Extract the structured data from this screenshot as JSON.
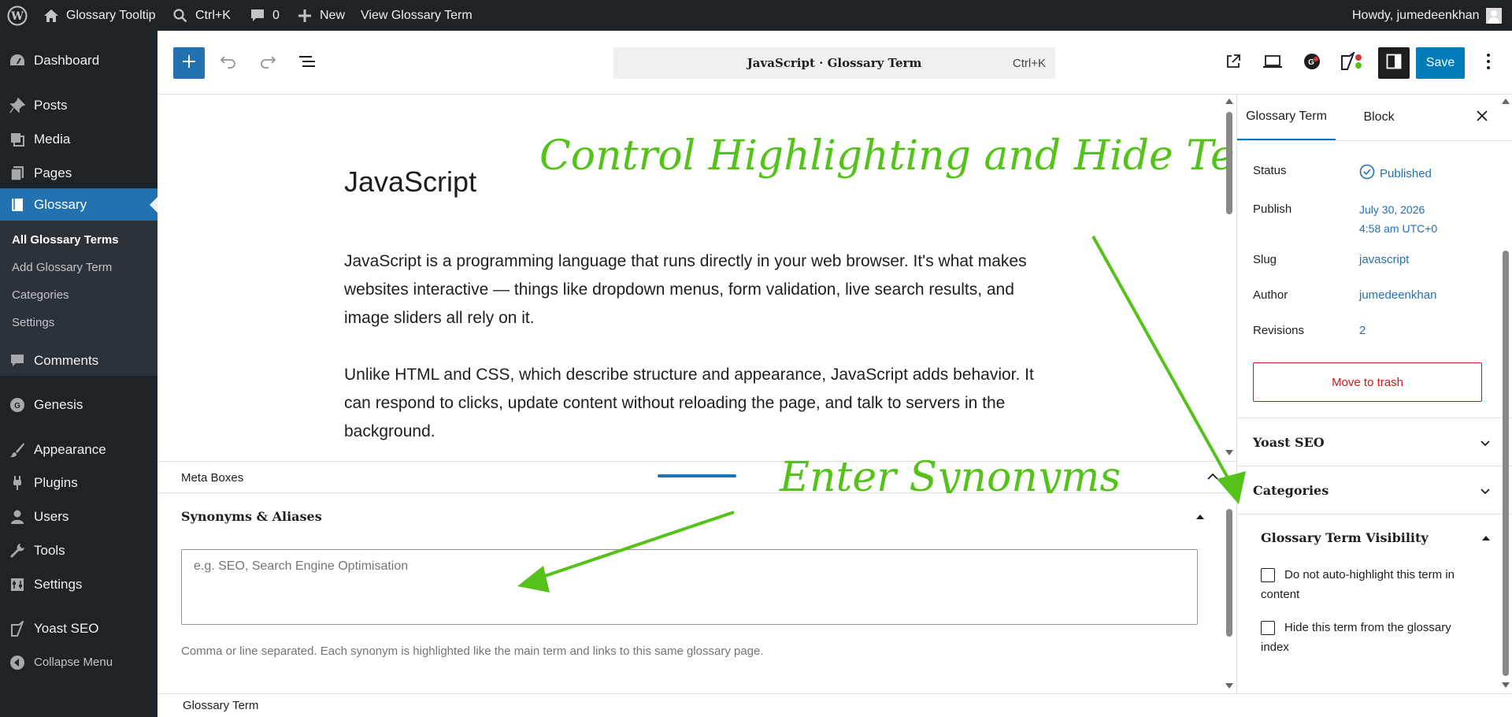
{
  "adminbar": {
    "site_name": "Glossary Tooltip",
    "search_shortcut": "Ctrl+K",
    "comments_count": "0",
    "new_label": "New",
    "view_label": "View Glossary Term",
    "howdy": "Howdy, jumedeenkhan"
  },
  "menu": {
    "dashboard": "Dashboard",
    "posts": "Posts",
    "media": "Media",
    "pages": "Pages",
    "glossary": "Glossary",
    "sub_all": "All Glossary Terms",
    "sub_add": "Add Glossary Term",
    "sub_categories": "Categories",
    "sub_settings": "Settings",
    "comments": "Comments",
    "genesis": "Genesis",
    "appearance": "Appearance",
    "plugins": "Plugins",
    "users": "Users",
    "tools": "Tools",
    "settings": "Settings",
    "yoast": "Yoast SEO",
    "collapse": "Collapse Menu"
  },
  "toolbar": {
    "doc_title": "JavaScript · Glossary Term",
    "shortcut": "Ctrl+K",
    "save_label": "Save"
  },
  "post": {
    "title": "JavaScript",
    "para1": "JavaScript is a programming language that runs directly in your web browser. It's what makes websites interactive — things like dropdown menus, form validation, live search results, and image sliders all rely on it.",
    "para2": "Unlike HTML and CSS, which describe structure and appearance, JavaScript adds behavior. It can respond to clicks, update content without reloading the page, and talk to servers in the background."
  },
  "annotations": {
    "top": "Control Highlighting and Hide Term",
    "mid": "Enter Synonyms"
  },
  "metaboxes": {
    "label": "Meta Boxes",
    "synonyms_title": "Synonyms & Aliases",
    "synonyms_placeholder": "e.g. SEO, Search Engine Optimisation",
    "synonyms_value": "",
    "synonyms_help": "Comma or line separated. Each synonym is highlighted like the main term and links to this same glossary page."
  },
  "footer": {
    "breadcrumb": "Glossary Term"
  },
  "sidebar": {
    "tab_doc": "Glossary Term",
    "tab_block": "Block",
    "status_label": "Status",
    "status_value": "Published",
    "publish_label": "Publish",
    "publish_date": "July 30, 2026",
    "publish_time": "4:58 am UTC+0",
    "slug_label": "Slug",
    "slug_value": "javascript",
    "author_label": "Author",
    "author_value": "jumedeenkhan",
    "revisions_label": "Revisions",
    "revisions_value": "2",
    "trash_label": "Move to trash",
    "yoast_panel": "Yoast SEO",
    "categories_panel": "Categories",
    "visibility_panel": "Glossary Term Visibility",
    "cb1_label": "Do not auto-highlight this term in content",
    "cb2_label": "Hide this term from the glossary index"
  },
  "colors": {
    "admin_bg": "#1d2327",
    "accent": "#2271b1",
    "save_bg": "#007cba",
    "annotation": "#55c21a",
    "danger": "#cc1818"
  }
}
